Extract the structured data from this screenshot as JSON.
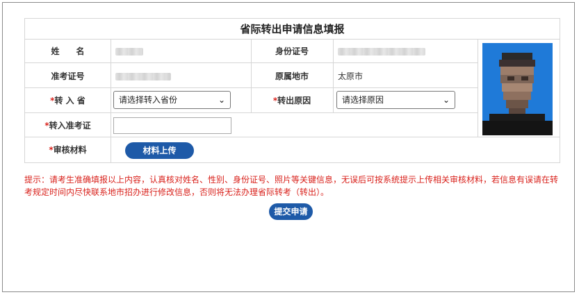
{
  "form": {
    "title": "省际转出申请信息填报",
    "name_label": "姓　　名",
    "id_label": "身份证号",
    "exam_no_label": "准考证号",
    "origin_label": "原属地市",
    "origin_value": "太原市",
    "transfer_province_label": "转 入 省",
    "transfer_reason_label": "转出原因",
    "province_select_value": "请选择转入省份",
    "reason_select_value": "请选择原因",
    "new_exam_no_label": "转入准考证",
    "materials_label": "审核材料",
    "required_mark": "*",
    "upload_button": "材料上传"
  },
  "notice": "提示：请考生准确填报以上内容，认真核对姓名、性别、身份证号、照片等关键信息，无误后可按系统提示上传相关审核材料，若信息有误请在转考规定时间内尽快联系地市招办进行修改信息，否则将无法办理省际转考（转出）。",
  "submit_button": "提交申请",
  "icons": {
    "select_arrow": "chevron-down-icon"
  },
  "colors": {
    "accent": "#1e5aa8",
    "required": "#d9221c",
    "photo_bg": "#1f7ad8"
  }
}
